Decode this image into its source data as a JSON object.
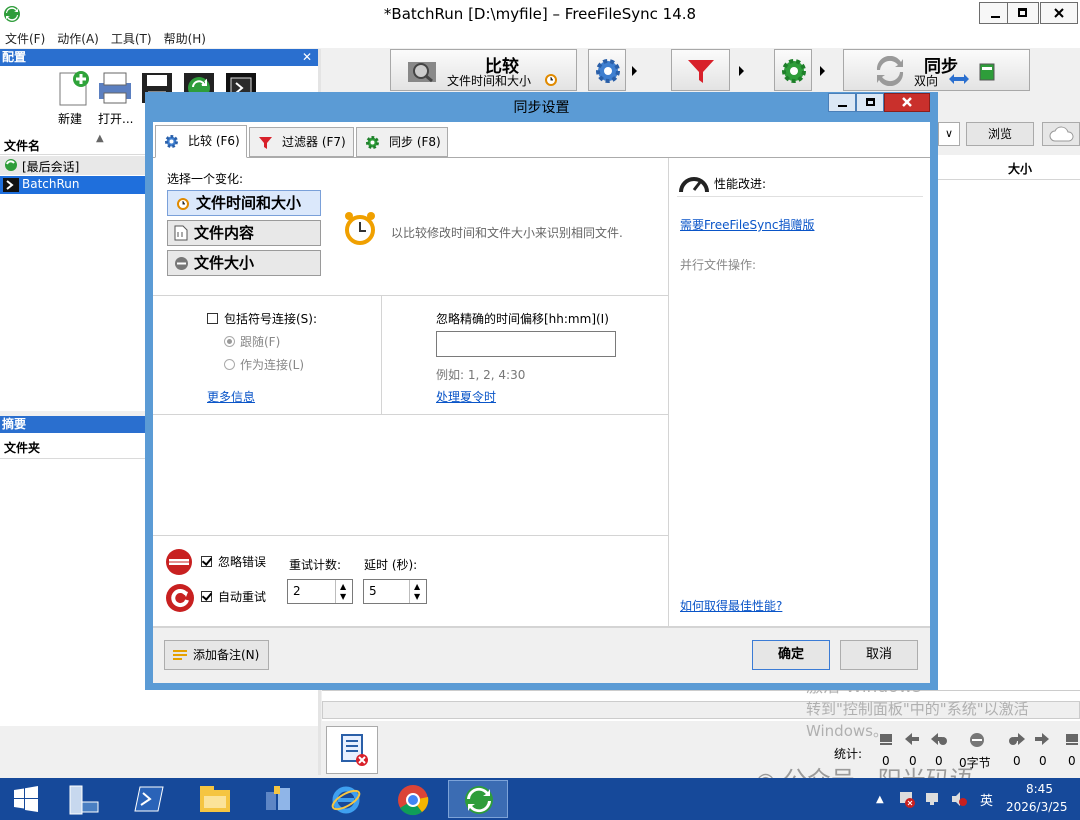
{
  "window": {
    "title": "*BatchRun [D:\\myfile] – FreeFileSync 14.8"
  },
  "menu": [
    "文件(F)",
    "动作(A)",
    "工具(T)",
    "帮助(H)"
  ],
  "config_panel": {
    "title": "配置",
    "new_label": "新建",
    "open_label": "打开...",
    "col_filename": "文件名",
    "items": [
      "[最后会话]",
      "BatchRun"
    ]
  },
  "summary_panel": {
    "title": "摘要",
    "col_folder": "文件夹"
  },
  "toolbar": {
    "compare_title": "比较",
    "compare_sub": "文件时间和大小",
    "sync_title": "同步",
    "sync_sub": "双向"
  },
  "right_area": {
    "browse_label": "浏览",
    "col_size": "大小"
  },
  "dialog": {
    "title": "同步设置",
    "tabs": [
      "比较 (F6)",
      "过滤器 (F7)",
      "同步 (F8)"
    ],
    "choose_variant": "选择一个变化:",
    "variants": [
      "文件时间和大小",
      "文件内容",
      "文件大小"
    ],
    "variant_desc": "以比较修改时间和文件大小来识别相同文件.",
    "symlink_label": "包括符号连接(S):",
    "follow_label": "跟随(F)",
    "as_link_label": "作为连接(L)",
    "more_info": "更多信息",
    "time_offset_label": "忽略精确的时间偏移[hh:mm](I)",
    "time_offset_value": "",
    "example": "例如: 1, 2, 4:30",
    "dst_link": "处理夏令时",
    "perf_title": "性能改进:",
    "donation_link": "需要FreeFileSync捐赠版",
    "parallel_label": "并行文件操作:",
    "best_perf_link": "如何取得最佳性能?",
    "ignore_errors": "忽略错误",
    "auto_retry": "自动重试",
    "retry_count_label": "重试计数:",
    "retry_count": "2",
    "delay_label": "延时 (秒):",
    "delay": "5",
    "add_note": "添加备注(N)",
    "ok": "确定",
    "cancel": "取消"
  },
  "stats": {
    "label": "统计:",
    "bytes": "0字节",
    "values": [
      "0",
      "0",
      "0",
      "0",
      "0",
      "0"
    ]
  },
  "watermark": {
    "line1": "激活 Windows",
    "line2": "转到\"控制面板\"中的\"系统\"以激活",
    "line3": "Windows。",
    "brand": "公众号 · 阳光码语"
  },
  "tray": {
    "ime": "英",
    "time": "8:45",
    "date": "2026/3/25"
  }
}
